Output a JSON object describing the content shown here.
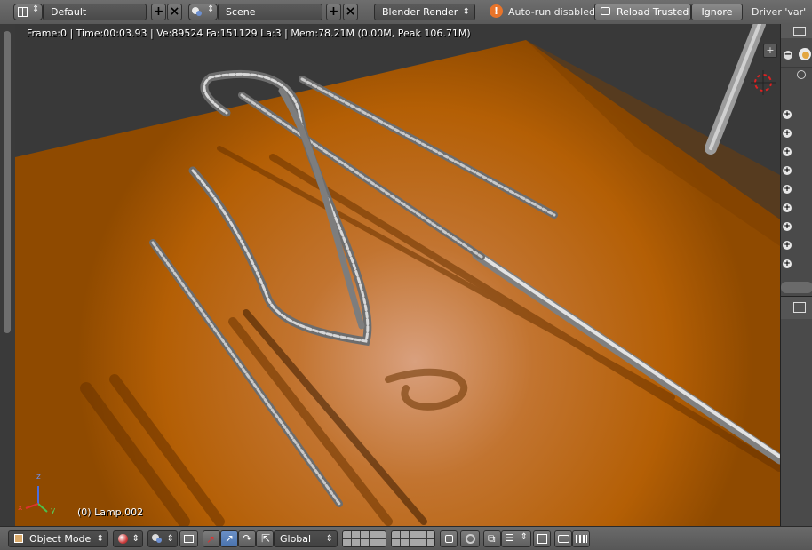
{
  "header": {
    "layout_screen": "Default",
    "scene": "Scene",
    "render_engine": "Blender Render",
    "autorun_warning": "Auto-run disabled",
    "reload_trusted_label": "Reload Trusted",
    "ignore_label": "Ignore",
    "driver_message": "Driver 'var'"
  },
  "viewport": {
    "info_text": "Frame:0 | Time:00:03.93 | Ve:89524 Fa:151129 La:3 | Mem:78.21M (0.00M, Peak 106.71M)",
    "active_object": "(0) Lamp.002",
    "axes": {
      "x": "x",
      "y": "y",
      "z": "z"
    }
  },
  "footer": {
    "mode": "Object Mode",
    "orientation": "Global"
  },
  "icons": {
    "editor_type": "grid-icon",
    "scene_icon": "scene-icon",
    "warning": "warning-icon",
    "reload": "reload-icon",
    "mode": "cube-icon",
    "shading": "sphere-icon",
    "pivot": "pivot-icon",
    "manipulator": "manipulator-icon",
    "translate": "arrow-icon",
    "rotate": "rotate-icon",
    "scale": "scale-icon",
    "layers": "layers-icon",
    "lock": "lock-icon",
    "snap": "magnet-icon",
    "render": "camera-icon"
  },
  "colors": {
    "floor": "#b35c00",
    "floor_light": "#d49a78",
    "background": "#393939",
    "accent_blue": "#5a82c0"
  }
}
